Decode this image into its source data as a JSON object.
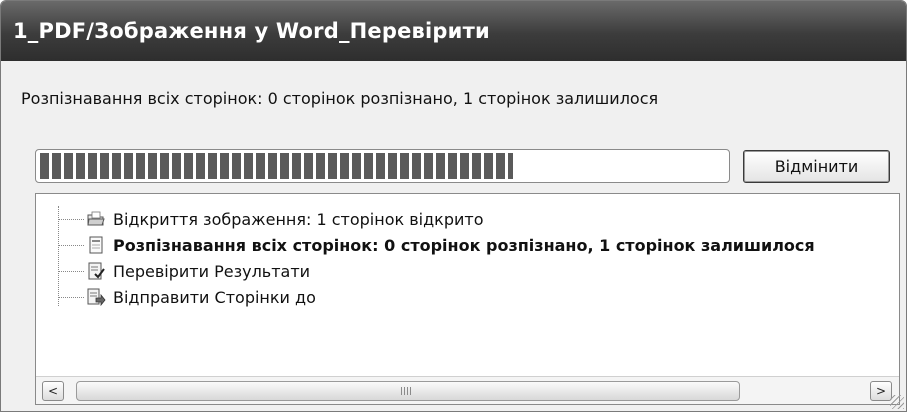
{
  "window": {
    "title": "1_PDF/Зображення у Word_Перевірити"
  },
  "status": {
    "text": "Розпізнавання всіх сторінок: 0 сторінок розпізнано, 1 сторінок залишилося"
  },
  "progress": {
    "fraction": 0.69
  },
  "buttons": {
    "cancel_label": "Відмінити"
  },
  "log": {
    "items": [
      {
        "label": "Відкриття зображення: 1 сторінок відкрито",
        "icon": "open-folder-icon",
        "bold": false
      },
      {
        "label": "Розпізнавання всіх сторінок: 0 сторінок розпізнано, 1 сторінок залишилося",
        "icon": "page-icon",
        "bold": true
      },
      {
        "label": "Перевірити Результати",
        "icon": "check-document-icon",
        "bold": false
      },
      {
        "label": "Відправити Сторінки до",
        "icon": "send-document-icon",
        "bold": false
      }
    ]
  },
  "scrollbar": {
    "left_glyph": "<",
    "right_glyph": ">"
  }
}
